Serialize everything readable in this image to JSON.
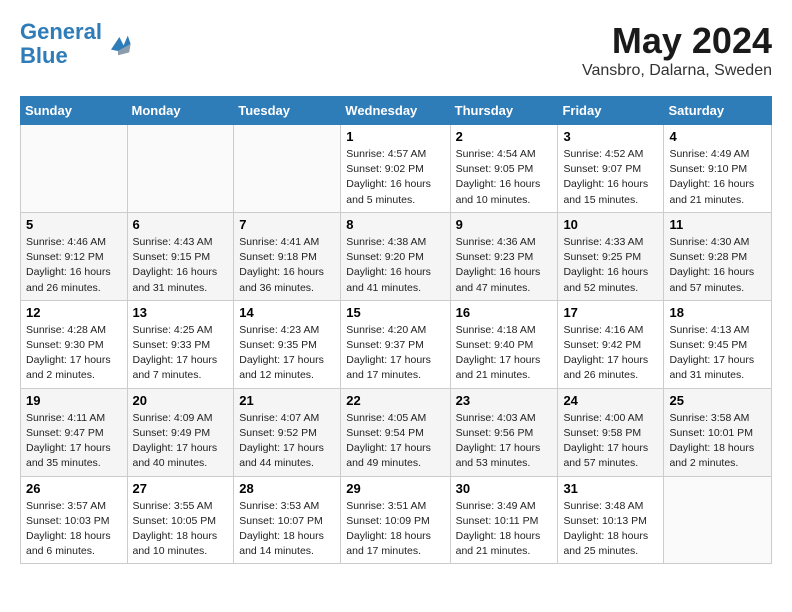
{
  "logo": {
    "line1": "General",
    "line2": "Blue"
  },
  "title": "May 2024",
  "location": "Vansbro, Dalarna, Sweden",
  "days_header": [
    "Sunday",
    "Monday",
    "Tuesday",
    "Wednesday",
    "Thursday",
    "Friday",
    "Saturday"
  ],
  "weeks": [
    [
      {
        "num": "",
        "info": ""
      },
      {
        "num": "",
        "info": ""
      },
      {
        "num": "",
        "info": ""
      },
      {
        "num": "1",
        "info": "Sunrise: 4:57 AM\nSunset: 9:02 PM\nDaylight: 16 hours\nand 5 minutes."
      },
      {
        "num": "2",
        "info": "Sunrise: 4:54 AM\nSunset: 9:05 PM\nDaylight: 16 hours\nand 10 minutes."
      },
      {
        "num": "3",
        "info": "Sunrise: 4:52 AM\nSunset: 9:07 PM\nDaylight: 16 hours\nand 15 minutes."
      },
      {
        "num": "4",
        "info": "Sunrise: 4:49 AM\nSunset: 9:10 PM\nDaylight: 16 hours\nand 21 minutes."
      }
    ],
    [
      {
        "num": "5",
        "info": "Sunrise: 4:46 AM\nSunset: 9:12 PM\nDaylight: 16 hours\nand 26 minutes."
      },
      {
        "num": "6",
        "info": "Sunrise: 4:43 AM\nSunset: 9:15 PM\nDaylight: 16 hours\nand 31 minutes."
      },
      {
        "num": "7",
        "info": "Sunrise: 4:41 AM\nSunset: 9:18 PM\nDaylight: 16 hours\nand 36 minutes."
      },
      {
        "num": "8",
        "info": "Sunrise: 4:38 AM\nSunset: 9:20 PM\nDaylight: 16 hours\nand 41 minutes."
      },
      {
        "num": "9",
        "info": "Sunrise: 4:36 AM\nSunset: 9:23 PM\nDaylight: 16 hours\nand 47 minutes."
      },
      {
        "num": "10",
        "info": "Sunrise: 4:33 AM\nSunset: 9:25 PM\nDaylight: 16 hours\nand 52 minutes."
      },
      {
        "num": "11",
        "info": "Sunrise: 4:30 AM\nSunset: 9:28 PM\nDaylight: 16 hours\nand 57 minutes."
      }
    ],
    [
      {
        "num": "12",
        "info": "Sunrise: 4:28 AM\nSunset: 9:30 PM\nDaylight: 17 hours\nand 2 minutes."
      },
      {
        "num": "13",
        "info": "Sunrise: 4:25 AM\nSunset: 9:33 PM\nDaylight: 17 hours\nand 7 minutes."
      },
      {
        "num": "14",
        "info": "Sunrise: 4:23 AM\nSunset: 9:35 PM\nDaylight: 17 hours\nand 12 minutes."
      },
      {
        "num": "15",
        "info": "Sunrise: 4:20 AM\nSunset: 9:37 PM\nDaylight: 17 hours\nand 17 minutes."
      },
      {
        "num": "16",
        "info": "Sunrise: 4:18 AM\nSunset: 9:40 PM\nDaylight: 17 hours\nand 21 minutes."
      },
      {
        "num": "17",
        "info": "Sunrise: 4:16 AM\nSunset: 9:42 PM\nDaylight: 17 hours\nand 26 minutes."
      },
      {
        "num": "18",
        "info": "Sunrise: 4:13 AM\nSunset: 9:45 PM\nDaylight: 17 hours\nand 31 minutes."
      }
    ],
    [
      {
        "num": "19",
        "info": "Sunrise: 4:11 AM\nSunset: 9:47 PM\nDaylight: 17 hours\nand 35 minutes."
      },
      {
        "num": "20",
        "info": "Sunrise: 4:09 AM\nSunset: 9:49 PM\nDaylight: 17 hours\nand 40 minutes."
      },
      {
        "num": "21",
        "info": "Sunrise: 4:07 AM\nSunset: 9:52 PM\nDaylight: 17 hours\nand 44 minutes."
      },
      {
        "num": "22",
        "info": "Sunrise: 4:05 AM\nSunset: 9:54 PM\nDaylight: 17 hours\nand 49 minutes."
      },
      {
        "num": "23",
        "info": "Sunrise: 4:03 AM\nSunset: 9:56 PM\nDaylight: 17 hours\nand 53 minutes."
      },
      {
        "num": "24",
        "info": "Sunrise: 4:00 AM\nSunset: 9:58 PM\nDaylight: 17 hours\nand 57 minutes."
      },
      {
        "num": "25",
        "info": "Sunrise: 3:58 AM\nSunset: 10:01 PM\nDaylight: 18 hours\nand 2 minutes."
      }
    ],
    [
      {
        "num": "26",
        "info": "Sunrise: 3:57 AM\nSunset: 10:03 PM\nDaylight: 18 hours\nand 6 minutes."
      },
      {
        "num": "27",
        "info": "Sunrise: 3:55 AM\nSunset: 10:05 PM\nDaylight: 18 hours\nand 10 minutes."
      },
      {
        "num": "28",
        "info": "Sunrise: 3:53 AM\nSunset: 10:07 PM\nDaylight: 18 hours\nand 14 minutes."
      },
      {
        "num": "29",
        "info": "Sunrise: 3:51 AM\nSunset: 10:09 PM\nDaylight: 18 hours\nand 17 minutes."
      },
      {
        "num": "30",
        "info": "Sunrise: 3:49 AM\nSunset: 10:11 PM\nDaylight: 18 hours\nand 21 minutes."
      },
      {
        "num": "31",
        "info": "Sunrise: 3:48 AM\nSunset: 10:13 PM\nDaylight: 18 hours\nand 25 minutes."
      },
      {
        "num": "",
        "info": ""
      }
    ]
  ]
}
